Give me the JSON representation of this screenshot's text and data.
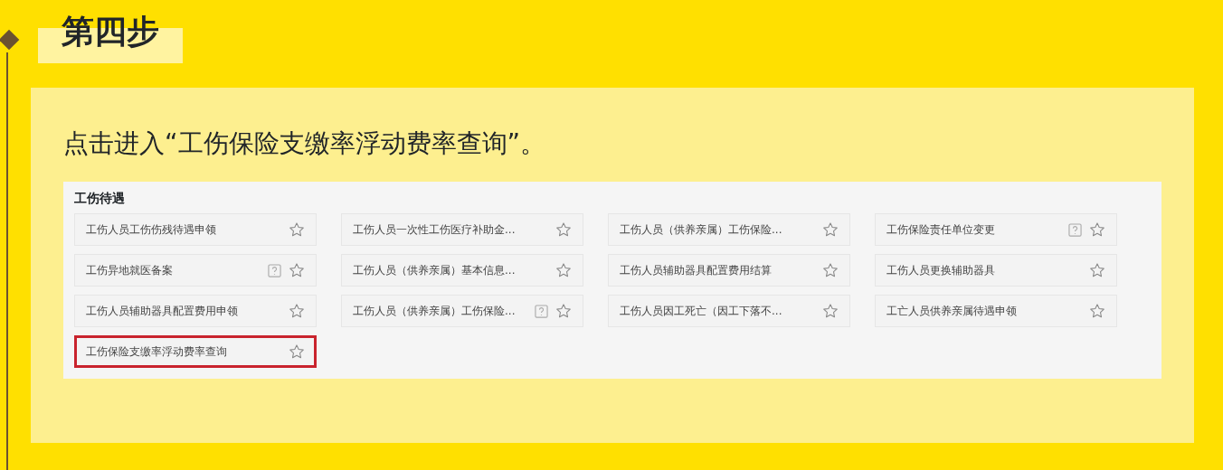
{
  "step_title": "第四步",
  "instruction": "点击进入“工伤保险支缴率浮动费率查询”。",
  "screenshot": {
    "section_title": "工伤待遇",
    "items": [
      {
        "label": "工伤人员工伤伤残待遇申领",
        "help": false,
        "highlighted": false
      },
      {
        "label": "工伤人员一次性工伤医疗补助金...",
        "help": false,
        "highlighted": false
      },
      {
        "label": "工伤人员（供养亲属）工伤保险...",
        "help": false,
        "highlighted": false
      },
      {
        "label": "工伤保险责任单位变更",
        "help": true,
        "highlighted": false
      },
      {
        "label": "工伤异地就医备案",
        "help": true,
        "highlighted": false
      },
      {
        "label": "工伤人员（供养亲属）基本信息...",
        "help": false,
        "highlighted": false
      },
      {
        "label": "工伤人员辅助器具配置费用结算",
        "help": false,
        "highlighted": false
      },
      {
        "label": "工伤人员更换辅助器具",
        "help": false,
        "highlighted": false
      },
      {
        "label": "工伤人员辅助器具配置费用申领",
        "help": false,
        "highlighted": false
      },
      {
        "label": "工伤人员（供养亲属）工伤保险...",
        "help": true,
        "highlighted": false
      },
      {
        "label": "工伤人员因工死亡（因工下落不...",
        "help": false,
        "highlighted": false
      },
      {
        "label": "工亡人员供养亲属待遇申领",
        "help": false,
        "highlighted": false
      },
      {
        "label": "工伤保险支缴率浮动费率查询",
        "help": false,
        "highlighted": true
      }
    ]
  }
}
